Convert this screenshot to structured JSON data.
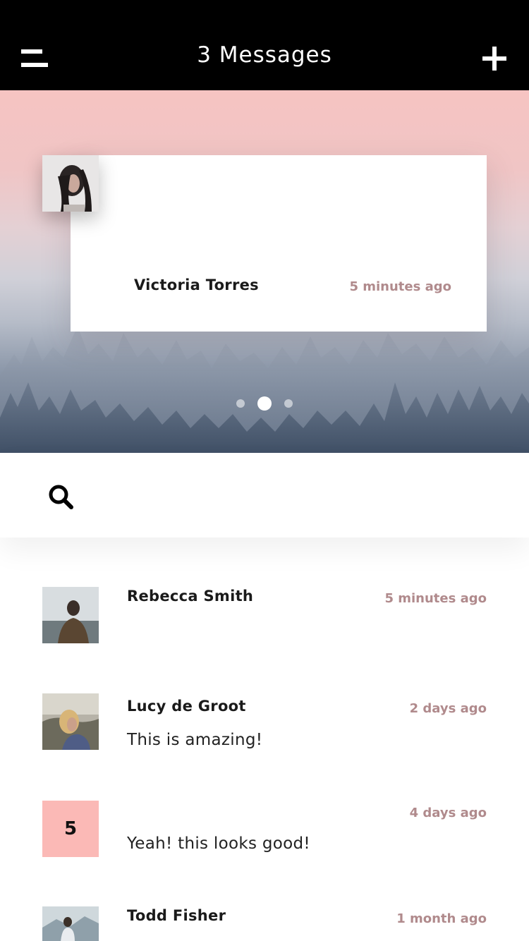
{
  "header": {
    "title": "3 Messages",
    "menu_icon": "menu-icon",
    "add_icon": "plus-icon"
  },
  "featured": {
    "name": "Victoria Torres",
    "time": "5 minutes ago",
    "active_slide": 2,
    "slide_count": 3
  },
  "search": {
    "icon": "search-icon"
  },
  "messages": [
    {
      "name": "Rebecca Smith",
      "time": "5 minutes ago",
      "text": ""
    },
    {
      "name": "Lucy de Groot",
      "time": "2 days ago",
      "text": "This is amazing!"
    },
    {
      "name": "",
      "badge": "5",
      "time": "4 days ago",
      "text": "Yeah! this looks good!"
    },
    {
      "name": "Todd Fisher",
      "time": "1 month ago",
      "text": ""
    }
  ],
  "colors": {
    "navbar": "#000000",
    "timestamp": "#b08a8c",
    "badge": "#fbb9b6",
    "hero_top": "#f6c4c2"
  }
}
